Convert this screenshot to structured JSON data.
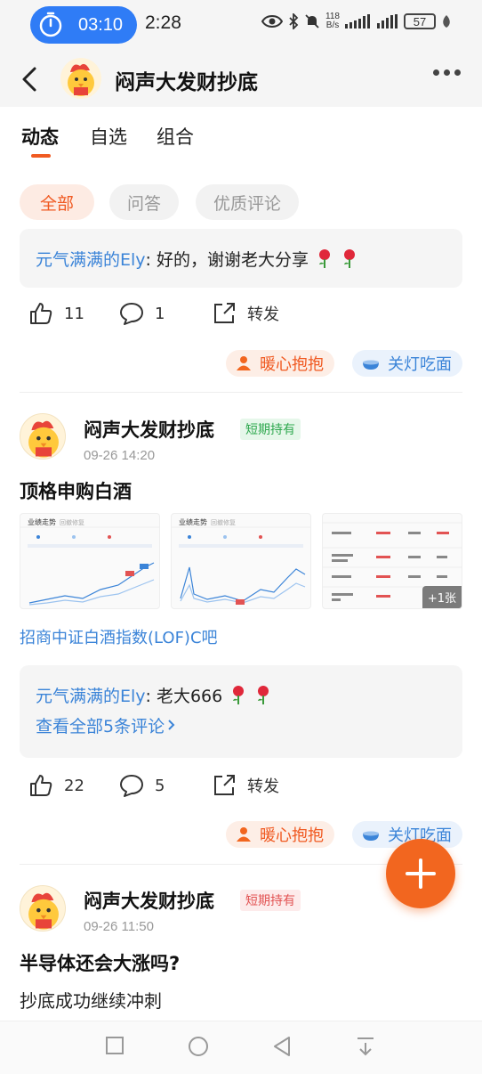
{
  "status_bar": {
    "timer": "03:10",
    "time": "2:28",
    "net_speed_value": "118",
    "net_speed_unit": "B/s",
    "battery": "57"
  },
  "header": {
    "title": "闷声大发财抄底"
  },
  "tabs": [
    {
      "label": "动态",
      "active": true
    },
    {
      "label": "自选",
      "active": false
    },
    {
      "label": "组合",
      "active": false
    }
  ],
  "filters": [
    {
      "label": "全部",
      "active": true
    },
    {
      "label": "问答",
      "active": false
    },
    {
      "label": "优质评论",
      "active": false
    }
  ],
  "post0": {
    "comment_user": "元气满满的Ely",
    "comment_text": ": 好的，谢谢老大分享",
    "likes": "11",
    "comments": "1",
    "forward": "转发",
    "chip_warm": "暖心抱抱",
    "chip_lamp": "关灯吃面"
  },
  "post1": {
    "author": "闷声大发财抄底",
    "badge": "短期持有",
    "time": "09-26 14:20",
    "title": "顶格申购白酒",
    "thumbs": [
      {
        "title": "业绩走势",
        "sub": "回撤修复"
      },
      {
        "title": "业绩走势",
        "sub": "回撤修复"
      }
    ],
    "more_images": "+1张",
    "link": "招商中证白酒指数(LOF)C吧",
    "comment_user": "元气满满的Ely",
    "comment_text": ": 老大666",
    "see_all": "查看全部5条评论",
    "likes": "22",
    "comments": "5",
    "forward": "转发",
    "chip_warm": "暖心抱抱",
    "chip_lamp": "关灯吃面"
  },
  "post2": {
    "author": "闷声大发财抄底",
    "badge": "短期持有",
    "time": "09-26 11:50",
    "title": "半导体还会大涨吗?",
    "body": "抄底成功继续冲刺"
  },
  "colors": {
    "accent": "#f05a22",
    "link": "#3b84d8",
    "timer_pill": "#2f7cf6"
  }
}
